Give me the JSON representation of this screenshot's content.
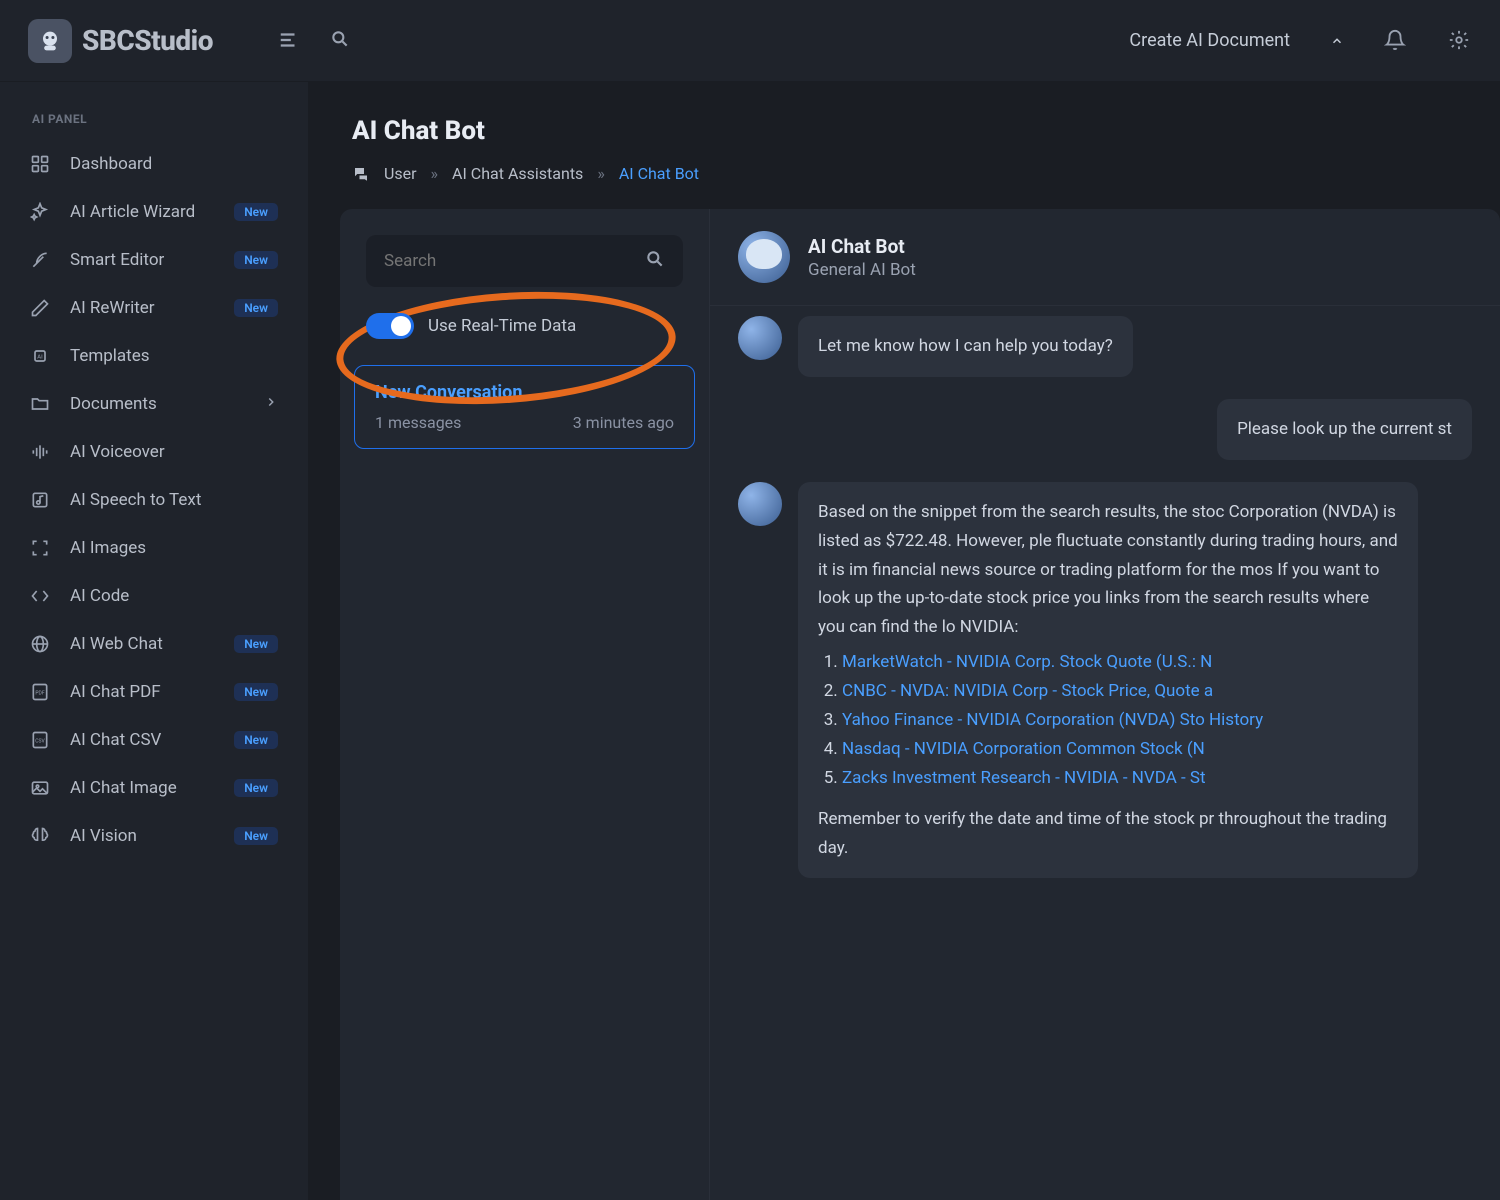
{
  "brand": "SBCStudio",
  "header": {
    "create_label": "Create AI Document"
  },
  "sidebar": {
    "section": "AI PANEL",
    "items": [
      {
        "label": "Dashboard",
        "icon": "grid",
        "badge": null,
        "chev": false
      },
      {
        "label": "AI Article Wizard",
        "icon": "sparkles",
        "badge": "New",
        "chev": false
      },
      {
        "label": "Smart Editor",
        "icon": "feather",
        "badge": "New",
        "chev": false
      },
      {
        "label": "AI ReWriter",
        "icon": "pencil",
        "badge": "New",
        "chev": false
      },
      {
        "label": "Templates",
        "icon": "chip",
        "badge": null,
        "chev": false
      },
      {
        "label": "Documents",
        "icon": "folder",
        "badge": null,
        "chev": true
      },
      {
        "label": "AI Voiceover",
        "icon": "wave",
        "badge": null,
        "chev": false
      },
      {
        "label": "AI Speech to Text",
        "icon": "music",
        "badge": null,
        "chev": false
      },
      {
        "label": "AI Images",
        "icon": "focus",
        "badge": null,
        "chev": false
      },
      {
        "label": "AI Code",
        "icon": "code",
        "badge": null,
        "chev": false
      },
      {
        "label": "AI Web Chat",
        "icon": "globe",
        "badge": "New",
        "chev": false
      },
      {
        "label": "AI Chat PDF",
        "icon": "pdf",
        "badge": "New",
        "chev": false
      },
      {
        "label": "AI Chat CSV",
        "icon": "csv",
        "badge": "New",
        "chev": false
      },
      {
        "label": "AI Chat Image",
        "icon": "image",
        "badge": "New",
        "chev": false
      },
      {
        "label": "AI Vision",
        "icon": "brain",
        "badge": "New",
        "chev": false
      }
    ]
  },
  "page": {
    "title": "AI Chat Bot",
    "crumbs": [
      "User",
      "AI Chat Assistants",
      "AI Chat Bot"
    ]
  },
  "convo": {
    "search_placeholder": "Search",
    "toggle_label": "Use Real-Time Data",
    "card": {
      "title": "New Conversation",
      "count": "1 messages",
      "time": "3 minutes ago"
    }
  },
  "chat": {
    "bot_name": "AI Chat Bot",
    "bot_sub": "General AI Bot",
    "msg_intro": "Let me know how I can help you today?",
    "msg_user": "Please look up the current st",
    "msg_reply_pre": "Based on the snippet from the search results, the stoc Corporation (NVDA) is listed as $722.48. However, ple fluctuate constantly during trading hours, and it is im financial news source or trading platform for the mos If you want to look up the up-to-date stock price you links from the search results where you can find the lo NVIDIA:",
    "links": [
      "MarketWatch - NVIDIA Corp. Stock Quote (U.S.: N",
      "CNBC - NVDA: NVIDIA Corp - Stock Price, Quote a",
      "Yahoo Finance - NVIDIA Corporation (NVDA) Sto History",
      "Nasdaq - NVIDIA Corporation Common Stock (N",
      "Zacks Investment Research - NVIDIA - NVDA - St"
    ],
    "msg_reply_post": "Remember to verify the date and time of the stock pr throughout the trading day."
  }
}
